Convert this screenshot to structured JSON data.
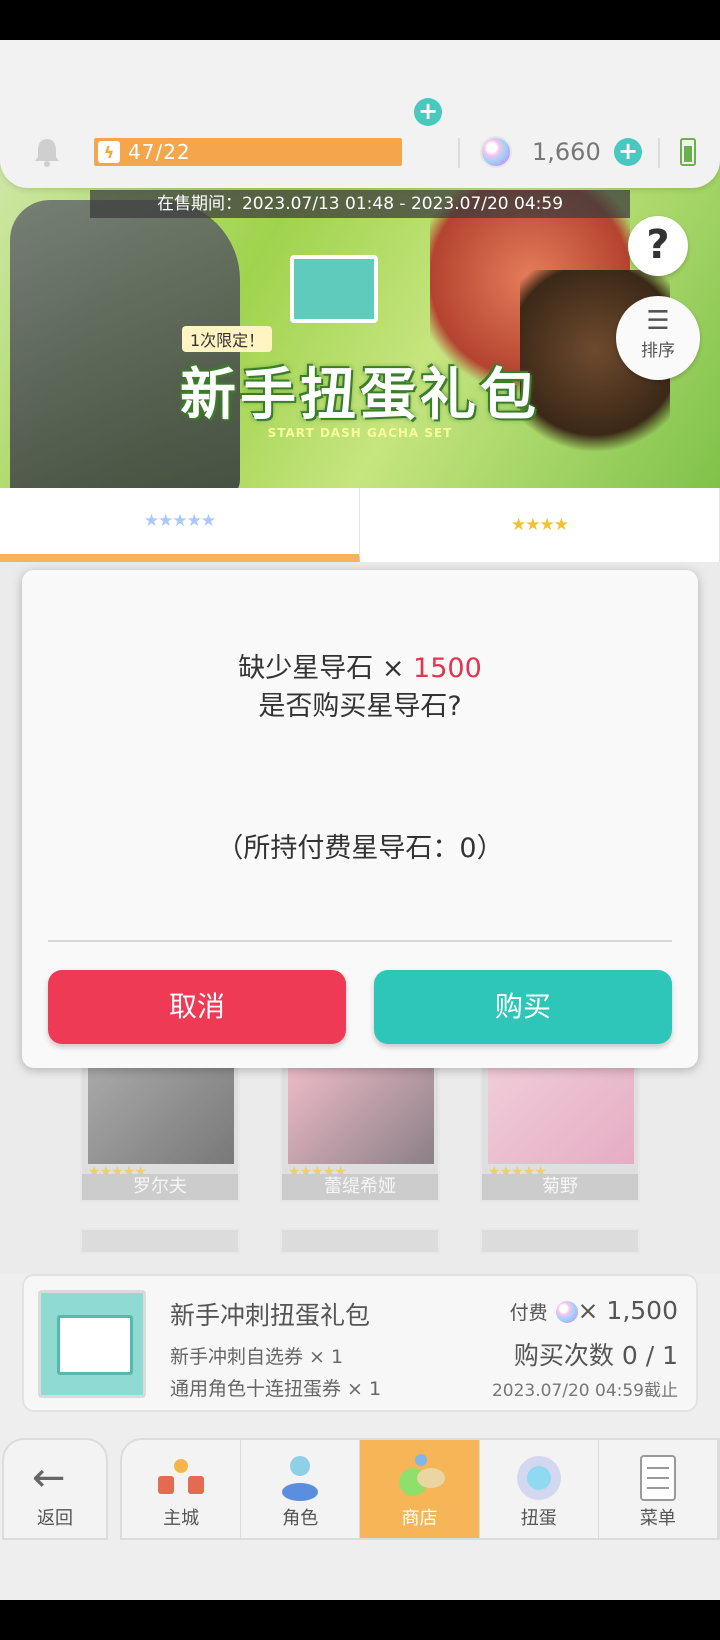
{
  "header": {
    "stamina_text": "47/22",
    "gem_count": "1,660"
  },
  "banner": {
    "sale_period": "在售期间：2023.07/13 01:48 - 2023.07/20 04:59",
    "limit_badge": "1次限定！",
    "title": "新手扭蛋礼包",
    "subtitle": "START DASH GACHA SET",
    "help_symbol": "?",
    "sort_label": "排序"
  },
  "tabs": [
    {
      "stars": "★★★★★"
    },
    {
      "stars": "★★★★"
    }
  ],
  "characters": [
    {
      "name": "罗尔夫",
      "stars": "★★★★★"
    },
    {
      "name": "蕾缇希娅",
      "stars": "★★★★★"
    },
    {
      "name": "菊野",
      "stars": "★★★★★"
    }
  ],
  "dialog": {
    "missing_prefix": "缺少星导石 × ",
    "missing_amount": "1500",
    "question": "是否购买星导石?",
    "held": "（所持付费星导石：0）",
    "cancel_label": "取消",
    "buy_label": "购买",
    "colors": {
      "cancel": "#ee3a55",
      "buy": "#2ec6b8",
      "amount": "#e2344f"
    }
  },
  "bundle": {
    "name": "新手冲刺扭蛋礼包",
    "item1": "新手冲刺自选券 × 1",
    "item2": "通用角色十连扭蛋券 × 1",
    "paid_label": "付费",
    "price": "× 1,500",
    "purchase_count": "购买次数 0 / 1",
    "deadline": "2023.07/20 04:59截止"
  },
  "nav": {
    "back": "返回",
    "items": [
      {
        "label": "主城",
        "icon": "town-icon"
      },
      {
        "label": "角色",
        "icon": "character-icon"
      },
      {
        "label": "商店",
        "icon": "shop-icon"
      },
      {
        "label": "扭蛋",
        "icon": "gacha-icon"
      },
      {
        "label": "菜单",
        "icon": "menu-icon"
      }
    ]
  }
}
